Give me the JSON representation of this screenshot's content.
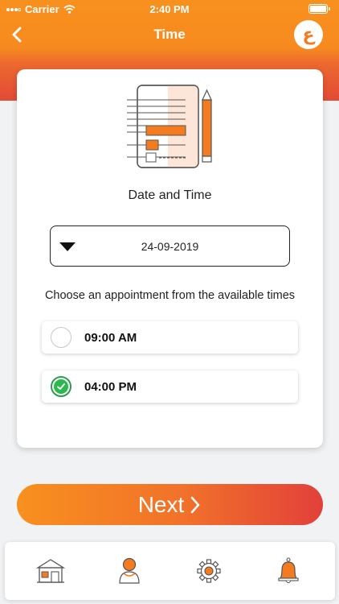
{
  "status_bar": {
    "carrier": "Carrier",
    "time": "2:40 PM"
  },
  "header": {
    "title": "Time",
    "lang_button": "ع"
  },
  "section": {
    "title": "Date and Time"
  },
  "date_picker": {
    "value": "24-09-2019"
  },
  "instruction": "Choose an appointment from the available times",
  "slots": [
    {
      "time": "09:00 AM",
      "selected": false
    },
    {
      "time": "04:00 PM",
      "selected": true
    }
  ],
  "next_button": {
    "label": "Next"
  },
  "tabs": [
    "home-icon",
    "profile-icon",
    "settings-icon",
    "notifications-icon"
  ],
  "colors": {
    "orange": "#f8901e",
    "red": "#e2403a",
    "green": "#2db84e"
  }
}
